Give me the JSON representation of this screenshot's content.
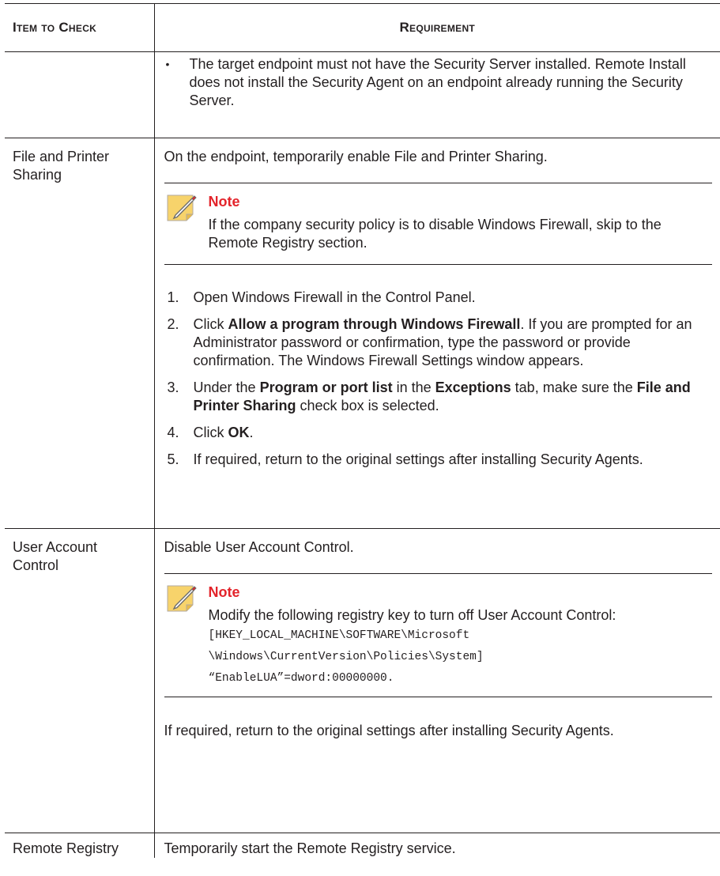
{
  "table": {
    "headers": {
      "item": "Item to Check",
      "requirement": "Requirement"
    },
    "row_continuation": {
      "bullet": "•",
      "text": "The target endpoint must not have the Security Server installed. Remote Install does not install the Security Agent on an endpoint already running the Security Server."
    },
    "row_file_printer": {
      "item": "File and Printer Sharing",
      "intro": "On the endpoint, temporarily enable File and Printer Sharing.",
      "note_title": "Note",
      "note_text": "If the company security policy is to disable Windows Firewall, skip to the Remote Registry section.",
      "steps": [
        {
          "num": "1.",
          "text": "Open Windows Firewall in the Control Panel."
        },
        {
          "num": "2.",
          "pre": "Click ",
          "bold": "Allow a program through Windows Firewall",
          "post": ". If you are prompted for an Administrator password or confirmation, type the password or provide confirmation. The Windows Firewall Settings window appears."
        },
        {
          "num": "3.",
          "a": "Under the ",
          "b1": "Program or port list",
          "c": " in the ",
          "b2": "Exceptions",
          "d": " tab, make sure the ",
          "b3": "File and Printer Sharing",
          "e": " check box is selected."
        },
        {
          "num": "4.",
          "pre": "Click ",
          "bold": "OK",
          "post": "."
        },
        {
          "num": "5.",
          "text": "If required, return to the original settings after installing Security Agents."
        }
      ]
    },
    "row_uac": {
      "item": "User Account Control",
      "intro": "Disable User Account Control.",
      "note_title": "Note",
      "note_text": "Modify the following registry key to turn off User Account Control: ",
      "note_code_1": "[HKEY_LOCAL_MACHINE\\SOFTWARE\\Microsoft",
      "note_code_2": "\\Windows\\CurrentVersion\\Policies\\System]",
      "note_code_3": "“EnableLUA”=dword:00000000",
      "note_code_end": ".",
      "outro": "If required, return to the original settings after installing Security Agents."
    },
    "row_remote_registry": {
      "item": "Remote Registry",
      "text": "Temporarily start the Remote Registry service."
    }
  },
  "colors": {
    "note_title": "#e3242b",
    "text": "#231f20",
    "note_icon_fill": "#f7d36b"
  },
  "icons": {
    "note": "note-pencil-icon"
  }
}
